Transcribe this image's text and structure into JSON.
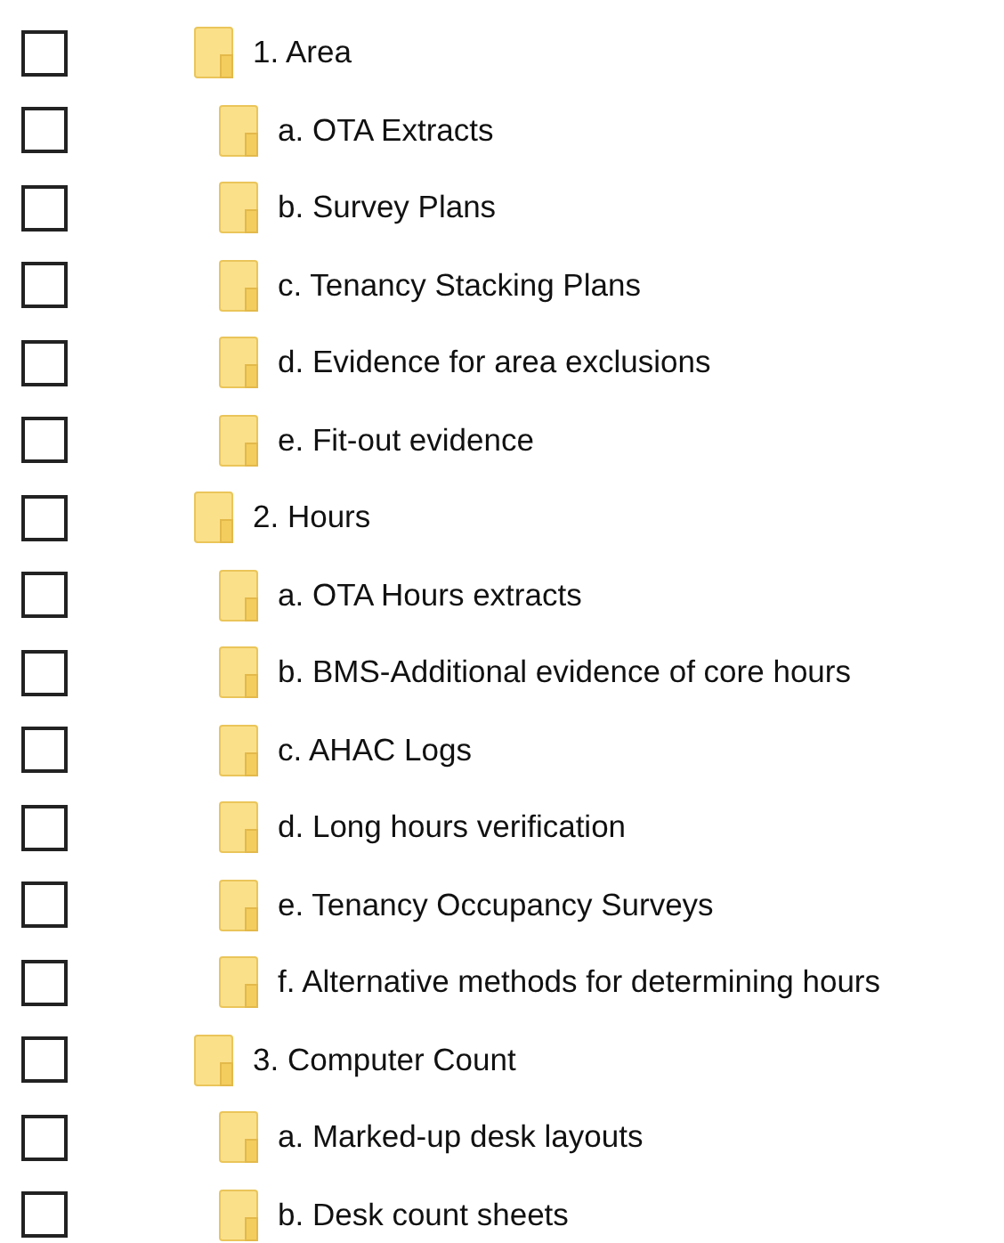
{
  "tree": [
    {
      "label": "1. Area",
      "checked": false,
      "children": [
        {
          "label": "a. OTA Extracts",
          "checked": false
        },
        {
          "label": "b. Survey Plans",
          "checked": false
        },
        {
          "label": "c. Tenancy Stacking Plans",
          "checked": false
        },
        {
          "label": "d. Evidence for area exclusions",
          "checked": false
        },
        {
          "label": "e. Fit-out evidence",
          "checked": false
        }
      ]
    },
    {
      "label": "2. Hours",
      "checked": false,
      "children": [
        {
          "label": "a. OTA Hours extracts",
          "checked": false
        },
        {
          "label": "b. BMS-Additional evidence of core hours",
          "checked": false
        },
        {
          "label": "c. AHAC Logs",
          "checked": false
        },
        {
          "label": "d. Long hours verification",
          "checked": false
        },
        {
          "label": "e. Tenancy Occupancy Surveys",
          "checked": false
        },
        {
          "label": "f. Alternative methods for determining hours",
          "checked": false
        }
      ]
    },
    {
      "label": "3. Computer Count",
      "checked": false,
      "children": [
        {
          "label": "a. Marked-up desk layouts",
          "checked": false
        },
        {
          "label": "b. Desk count sheets",
          "checked": false
        }
      ]
    }
  ]
}
